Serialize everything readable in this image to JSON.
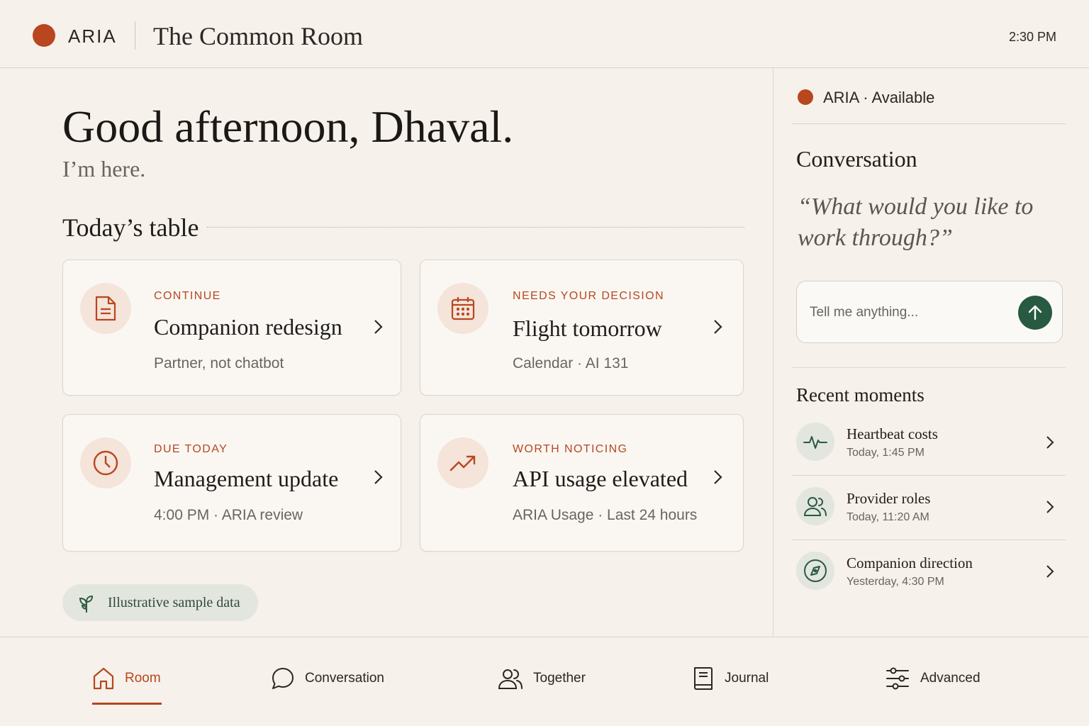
{
  "header": {
    "brand": "ARIA",
    "room_title": "The Common Room",
    "time": "2:30 PM"
  },
  "main": {
    "greeting": "Good afternoon, Dhaval.",
    "subgreeting": "I’m here.",
    "section_title": "Today’s table",
    "cards": [
      {
        "kicker": "CONTINUE",
        "title": "Companion redesign",
        "meta": "Partner, not chatbot",
        "icon": "document-icon"
      },
      {
        "kicker": "NEEDS YOUR DECISION",
        "title": "Flight tomorrow",
        "meta": "Calendar · AI 131",
        "icon": "calendar-icon"
      },
      {
        "kicker": "DUE TODAY",
        "title": "Management update",
        "meta": "4:00 PM · ARIA review",
        "icon": "clock-icon"
      },
      {
        "kicker": "WORTH NOTICING",
        "title": "API usage elevated",
        "meta": "ARIA Usage · Last 24 hours",
        "icon": "trend-up-icon"
      }
    ],
    "sample_pill": "Illustrative sample data"
  },
  "panel": {
    "status": "ARIA · Available",
    "conversation_title": "Conversation",
    "quote": "“What would you like to work through?”",
    "chat_placeholder": "Tell me anything...",
    "recent_title": "Recent moments",
    "moments": [
      {
        "title": "Heartbeat costs",
        "time": "Today, 1:45 PM",
        "icon": "pulse-icon"
      },
      {
        "title": "Provider roles",
        "time": "Today, 11:20 AM",
        "icon": "people-icon"
      },
      {
        "title": "Companion direction",
        "time": "Yesterday, 4:30 PM",
        "icon": "compass-icon"
      }
    ]
  },
  "nav": [
    {
      "label": "Room",
      "icon": "home-icon",
      "active": true
    },
    {
      "label": "Conversation",
      "icon": "chat-bubble-icon"
    },
    {
      "label": "Together",
      "icon": "people-icon"
    },
    {
      "label": "Journal",
      "icon": "journal-icon"
    },
    {
      "label": "Advanced",
      "icon": "sliders-icon"
    }
  ],
  "colors": {
    "accent": "#b8461f",
    "green": "#275a40",
    "background": "#f6f1ea"
  }
}
